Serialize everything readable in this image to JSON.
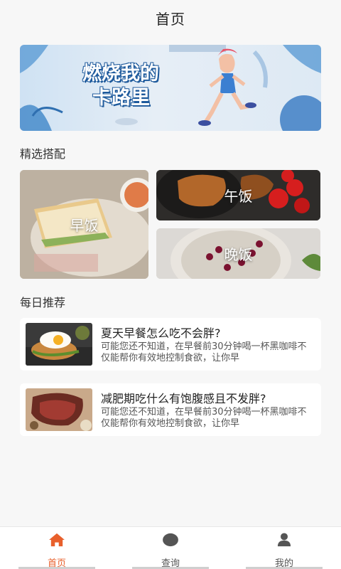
{
  "header": {
    "title": "首页"
  },
  "banner": {
    "line1": "燃烧我的",
    "line2": "卡路里"
  },
  "featured": {
    "title": "精选搭配",
    "items": [
      {
        "label": "早饭"
      },
      {
        "label": "午饭"
      },
      {
        "label": "晚饭"
      }
    ]
  },
  "daily": {
    "title": "每日推荐",
    "articles": [
      {
        "title": "夏天早餐怎么吃不会胖?",
        "summary": "可能您还不知道，在早餐前30分钟喝一杯黑咖啡不仅能帮你有效地控制食欲，让你早"
      },
      {
        "title": "减肥期吃什么有饱腹感且不发胖?",
        "summary": "可能您还不知道，在早餐前30分钟喝一杯黑咖啡不仅能帮你有效地控制食欲，让你早"
      }
    ]
  },
  "tabbar": {
    "tabs": [
      {
        "label": "首页",
        "icon": "home-icon"
      },
      {
        "label": "查询",
        "icon": "search-icon"
      },
      {
        "label": "我的",
        "icon": "user-icon"
      }
    ],
    "active_color": "#e8602c"
  }
}
